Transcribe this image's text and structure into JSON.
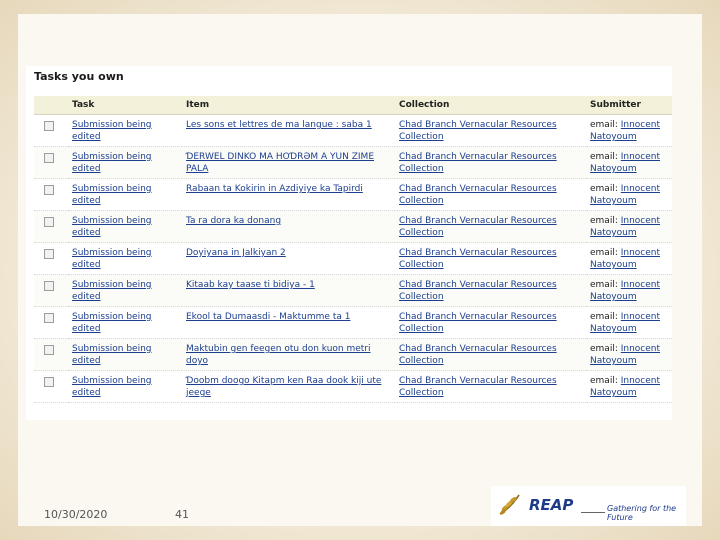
{
  "panel": {
    "title": "Tasks you own"
  },
  "table": {
    "headers": {
      "task": "Task",
      "item": "Item",
      "collection": "Collection",
      "submitter": "Submitter"
    },
    "rows": [
      {
        "task": "Submission being edited",
        "item": "Les sons et lettres de ma langue : saba 1",
        "collection": "Chad Branch Vernacular Resources Collection",
        "submitter_prefix": "email:",
        "submitter_name": "Innocent Natoyoum"
      },
      {
        "task": "Submission being edited",
        "item": "ƊERWEL DINKO MA HOƊRƏM A YUN ZIME PALA",
        "collection": "Chad Branch Vernacular Resources Collection",
        "submitter_prefix": "email:",
        "submitter_name": "Innocent Natoyoum"
      },
      {
        "task": "Submission being edited",
        "item": "Rabaan ta Kokirin in Azdiyiye ka Tapirdi",
        "collection": "Chad Branch Vernacular Resources Collection",
        "submitter_prefix": "email:",
        "submitter_name": "Innocent Natoyoum"
      },
      {
        "task": "Submission being edited",
        "item": "Ta ra dora ka donang",
        "collection": "Chad Branch Vernacular Resources Collection",
        "submitter_prefix": "email:",
        "submitter_name": "Innocent Natoyoum"
      },
      {
        "task": "Submission being edited",
        "item": "Doyiyana in Jalkiyan 2",
        "collection": "Chad Branch Vernacular Resources Collection",
        "submitter_prefix": "email:",
        "submitter_name": "Innocent Natoyoum"
      },
      {
        "task": "Submission being edited",
        "item": "Kitaab kay taase ti bidiya - 1",
        "collection": "Chad Branch Vernacular Resources Collection",
        "submitter_prefix": "email:",
        "submitter_name": "Innocent Natoyoum"
      },
      {
        "task": "Submission being edited",
        "item": "Ekool ta Dumaasdi - Maktumme ta 1",
        "collection": "Chad Branch Vernacular Resources Collection",
        "submitter_prefix": "email:",
        "submitter_name": "Innocent Natoyoum"
      },
      {
        "task": "Submission being edited",
        "item": "Maktubin gen feegen otu don kuon metri doyo",
        "collection": "Chad Branch Vernacular Resources Collection",
        "submitter_prefix": "email:",
        "submitter_name": "Innocent Natoyoum"
      },
      {
        "task": "Submission being edited",
        "item": "Ɗoobm doogo Kitapm ken Raa dook kiji ute jeege",
        "collection": "Chad Branch Vernacular Resources Collection",
        "submitter_prefix": "email:",
        "submitter_name": "Innocent Natoyoum"
      }
    ]
  },
  "footer": {
    "date": "10/30/2020",
    "page": "41"
  },
  "logo": {
    "name": "REAP",
    "tagline": "Gathering for the Future",
    "icon": "reap-wheat-icon"
  }
}
